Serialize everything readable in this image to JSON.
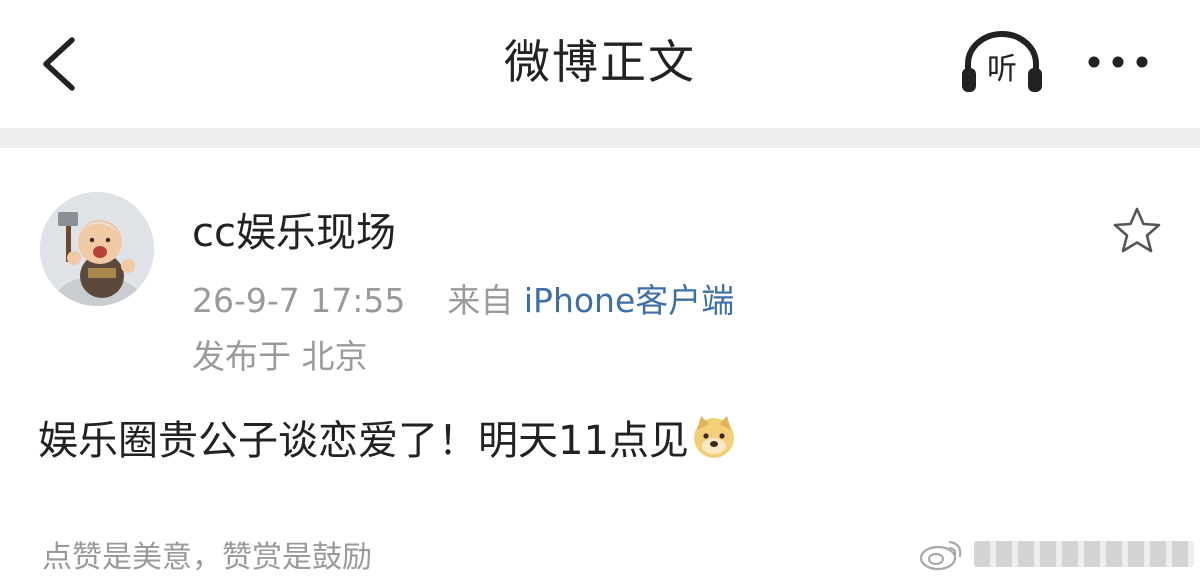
{
  "header": {
    "title": "微博正文",
    "listen_label": "听"
  },
  "post": {
    "username": "cc娱乐现场",
    "timestamp": "26-9-7 17:55",
    "source_prefix": "来自",
    "source_app": "iPhone客户端",
    "location": "发布于 北京",
    "body_text": "娱乐圈贵公子谈恋爱了！明天11点见",
    "emoji": "doge-emoji"
  },
  "footer": {
    "reward_text": "点赞是美意，赞赏是鼓励"
  },
  "icons": {
    "back": "chevron-left-icon",
    "listen": "headphones-icon",
    "more": "more-dots-icon",
    "favorite": "star-outline-icon",
    "watermark": "weibo-logo-icon"
  },
  "colors": {
    "text_primary": "#222222",
    "text_secondary": "#9a9a9a",
    "link": "#3d6fa8",
    "separator": "#efefef"
  }
}
